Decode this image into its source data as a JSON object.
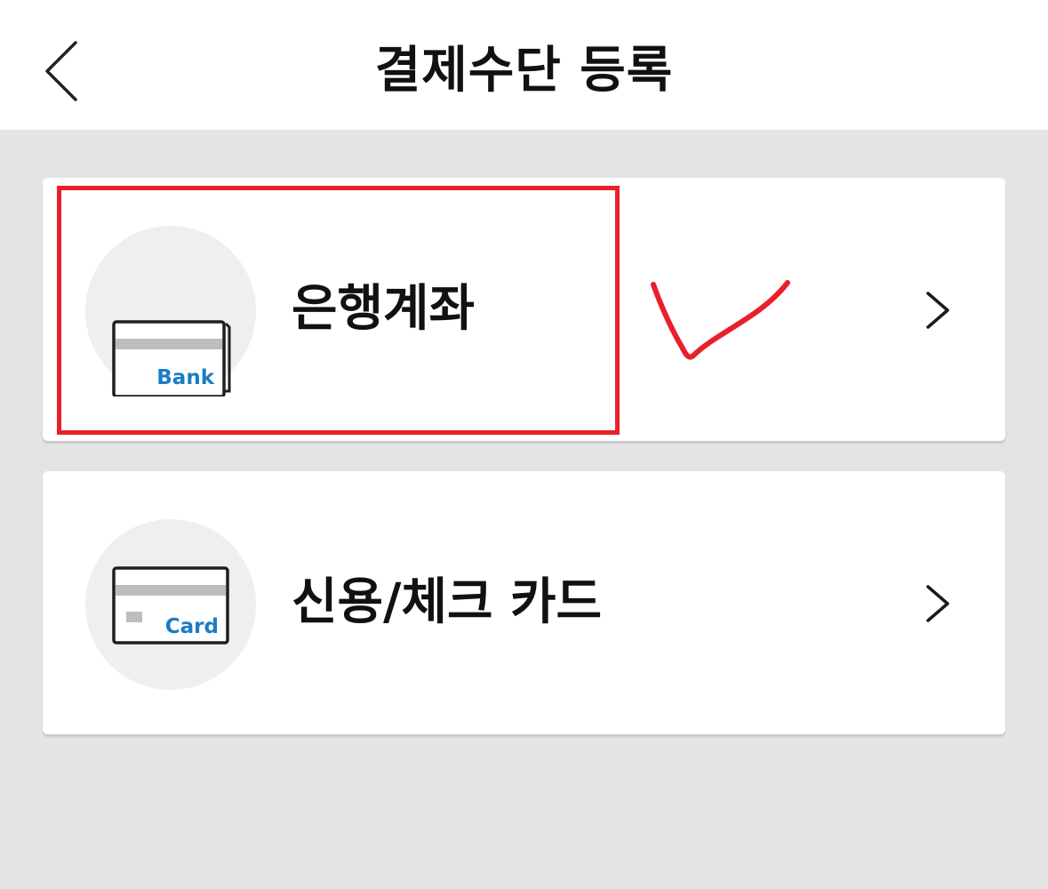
{
  "header": {
    "title": "결제수단 등록",
    "back_icon": "chevron-left-icon"
  },
  "options": [
    {
      "label": "은행계좌",
      "icon": "bank-card-icon",
      "icon_text": "Bank"
    },
    {
      "label": "신용/체크 카드",
      "icon": "credit-card-icon",
      "icon_text": "Card"
    }
  ],
  "annotations": {
    "highlight_color": "#e8202a",
    "checkmark_color": "#e8202a"
  },
  "colors": {
    "icon_accent": "#1a7cc4",
    "background": "#e4e4e4"
  }
}
